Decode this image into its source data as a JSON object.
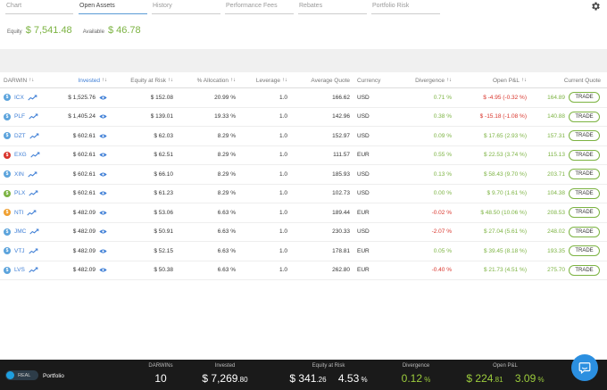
{
  "tabs": [
    {
      "label": "Chart"
    },
    {
      "label": "Open Assets"
    },
    {
      "label": "History"
    },
    {
      "label": "Performance Fees"
    },
    {
      "label": "Rebates"
    },
    {
      "label": "Portfolio Risk"
    }
  ],
  "active_tab": "Open Assets",
  "summary": {
    "equity_label": "Equity",
    "equity_value": "$ 7,541.48",
    "available_label": "Available",
    "available_value": "$ 46.78"
  },
  "columns": {
    "darwin": "DARWIN",
    "invested": "Invested",
    "equity_at_risk": "Equity at Risk",
    "allocation": "% Allocation",
    "leverage": "Leverage",
    "average_quote": "Average Quote",
    "currency": "Currency",
    "divergence": "Divergence",
    "open_pl": "Open P&L",
    "current_quote": "Current Quote"
  },
  "sort_indicator": "↑↓",
  "rows": [
    {
      "coin_color": "#5ba3dc",
      "ticker": "ICX",
      "invested": "$ 1,525.76",
      "equity_at_risk": "$ 152.08",
      "allocation": "20.99 %",
      "leverage": "1.0",
      "average_quote": "166.62",
      "currency": "USD",
      "divergence": "0.71 %",
      "divergence_color": "#7cb342",
      "open_pl": "$ -4.95 (-0.32 %)",
      "open_pl_color": "#d9342b",
      "current_quote": "164.89",
      "trade_label": "TRADE"
    },
    {
      "coin_color": "#5ba3dc",
      "ticker": "PLF",
      "invested": "$ 1,405.24",
      "equity_at_risk": "$ 139.01",
      "allocation": "19.33 %",
      "leverage": "1.0",
      "average_quote": "142.96",
      "currency": "USD",
      "divergence": "0.38 %",
      "divergence_color": "#7cb342",
      "open_pl": "$ -15.18 (-1.08 %)",
      "open_pl_color": "#d9342b",
      "current_quote": "140.88",
      "trade_label": "TRADE"
    },
    {
      "coin_color": "#5ba3dc",
      "ticker": "DZT",
      "invested": "$ 602.61",
      "equity_at_risk": "$ 62.03",
      "allocation": "8.29 %",
      "leverage": "1.0",
      "average_quote": "152.97",
      "currency": "USD",
      "divergence": "0.09 %",
      "divergence_color": "#7cb342",
      "open_pl": "$ 17.65 (2.93 %)",
      "open_pl_color": "#7cb342",
      "current_quote": "157.31",
      "trade_label": "TRADE"
    },
    {
      "coin_color": "#d9342b",
      "ticker": "EXG",
      "invested": "$ 602.61",
      "equity_at_risk": "$ 62.51",
      "allocation": "8.29 %",
      "leverage": "1.0",
      "average_quote": "111.57",
      "currency": "EUR",
      "divergence": "0.55 %",
      "divergence_color": "#7cb342",
      "open_pl": "$ 22.53 (3.74 %)",
      "open_pl_color": "#7cb342",
      "current_quote": "115.13",
      "trade_label": "TRADE"
    },
    {
      "coin_color": "#5ba3dc",
      "ticker": "XIN",
      "invested": "$ 602.61",
      "equity_at_risk": "$ 66.10",
      "allocation": "8.29 %",
      "leverage": "1.0",
      "average_quote": "185.93",
      "currency": "USD",
      "divergence": "0.13 %",
      "divergence_color": "#7cb342",
      "open_pl": "$ 58.43 (9.70 %)",
      "open_pl_color": "#7cb342",
      "current_quote": "203.71",
      "trade_label": "TRADE"
    },
    {
      "coin_color": "#7cb342",
      "ticker": "PLX",
      "invested": "$ 602.61",
      "equity_at_risk": "$ 61.23",
      "allocation": "8.29 %",
      "leverage": "1.0",
      "average_quote": "102.73",
      "currency": "USD",
      "divergence": "0.00 %",
      "divergence_color": "#7cb342",
      "open_pl": "$ 9.70 (1.61 %)",
      "open_pl_color": "#7cb342",
      "current_quote": "104.38",
      "trade_label": "TRADE"
    },
    {
      "coin_color": "#f0a030",
      "ticker": "NTI",
      "invested": "$ 482.09",
      "equity_at_risk": "$ 53.06",
      "allocation": "6.63 %",
      "leverage": "1.0",
      "average_quote": "189.44",
      "currency": "EUR",
      "divergence": "-0.02 %",
      "divergence_color": "#d9342b",
      "open_pl": "$ 48.50 (10.06 %)",
      "open_pl_color": "#7cb342",
      "current_quote": "208.53",
      "trade_label": "TRADE"
    },
    {
      "coin_color": "#5ba3dc",
      "ticker": "JMC",
      "invested": "$ 482.09",
      "equity_at_risk": "$ 50.91",
      "allocation": "6.63 %",
      "leverage": "1.0",
      "average_quote": "230.33",
      "currency": "USD",
      "divergence": "-2.07 %",
      "divergence_color": "#d9342b",
      "open_pl": "$ 27.04 (5.61 %)",
      "open_pl_color": "#7cb342",
      "current_quote": "248.02",
      "trade_label": "TRADE"
    },
    {
      "coin_color": "#5ba3dc",
      "ticker": "VTJ",
      "invested": "$ 482.09",
      "equity_at_risk": "$ 52.15",
      "allocation": "6.63 %",
      "leverage": "1.0",
      "average_quote": "178.81",
      "currency": "EUR",
      "divergence": "0.05 %",
      "divergence_color": "#7cb342",
      "open_pl": "$ 39.45 (8.18 %)",
      "open_pl_color": "#7cb342",
      "current_quote": "193.35",
      "trade_label": "TRADE"
    },
    {
      "coin_color": "#5ba3dc",
      "ticker": "LVS",
      "invested": "$ 482.09",
      "equity_at_risk": "$ 50.38",
      "allocation": "6.63 %",
      "leverage": "1.0",
      "average_quote": "262.80",
      "currency": "EUR",
      "divergence": "-0.40 %",
      "divergence_color": "#d9342b",
      "open_pl": "$ 21.73 (4.51 %)",
      "open_pl_color": "#7cb342",
      "current_quote": "275.70",
      "trade_label": "TRADE"
    }
  ],
  "footer": {
    "toggle_label": "REAL",
    "portfolio_label": "Portfolio",
    "darwins_label": "DARWINs",
    "darwins_value": "10",
    "invested_label": "Invested",
    "invested_main": "$ 7,269",
    "invested_cents": ".80",
    "equity_label": "Equity at Risk",
    "equity_main": "$ 341",
    "equity_cents": ".26",
    "equity_pct_main": "4.53",
    "equity_pct_unit": " %",
    "divergence_label": "Divergence",
    "divergence_main": "0.12",
    "divergence_unit": " %",
    "open_pl_label": "Open P&L",
    "open_pl_main": "$ 224",
    "open_pl_cents": ".81",
    "open_pl_pct_main": "3.09",
    "open_pl_pct_unit": " %"
  },
  "icons": {
    "settings": "gear-icon",
    "trend": "trend-line-icon",
    "view": "eye-icon",
    "chat": "chat-bubble-icon"
  },
  "colors": {
    "accent_blue": "#3f7fd6",
    "positive": "#7cb342",
    "negative": "#d9342b",
    "footer_bg": "#1a1a1a",
    "chat": "#2b8fe0"
  }
}
